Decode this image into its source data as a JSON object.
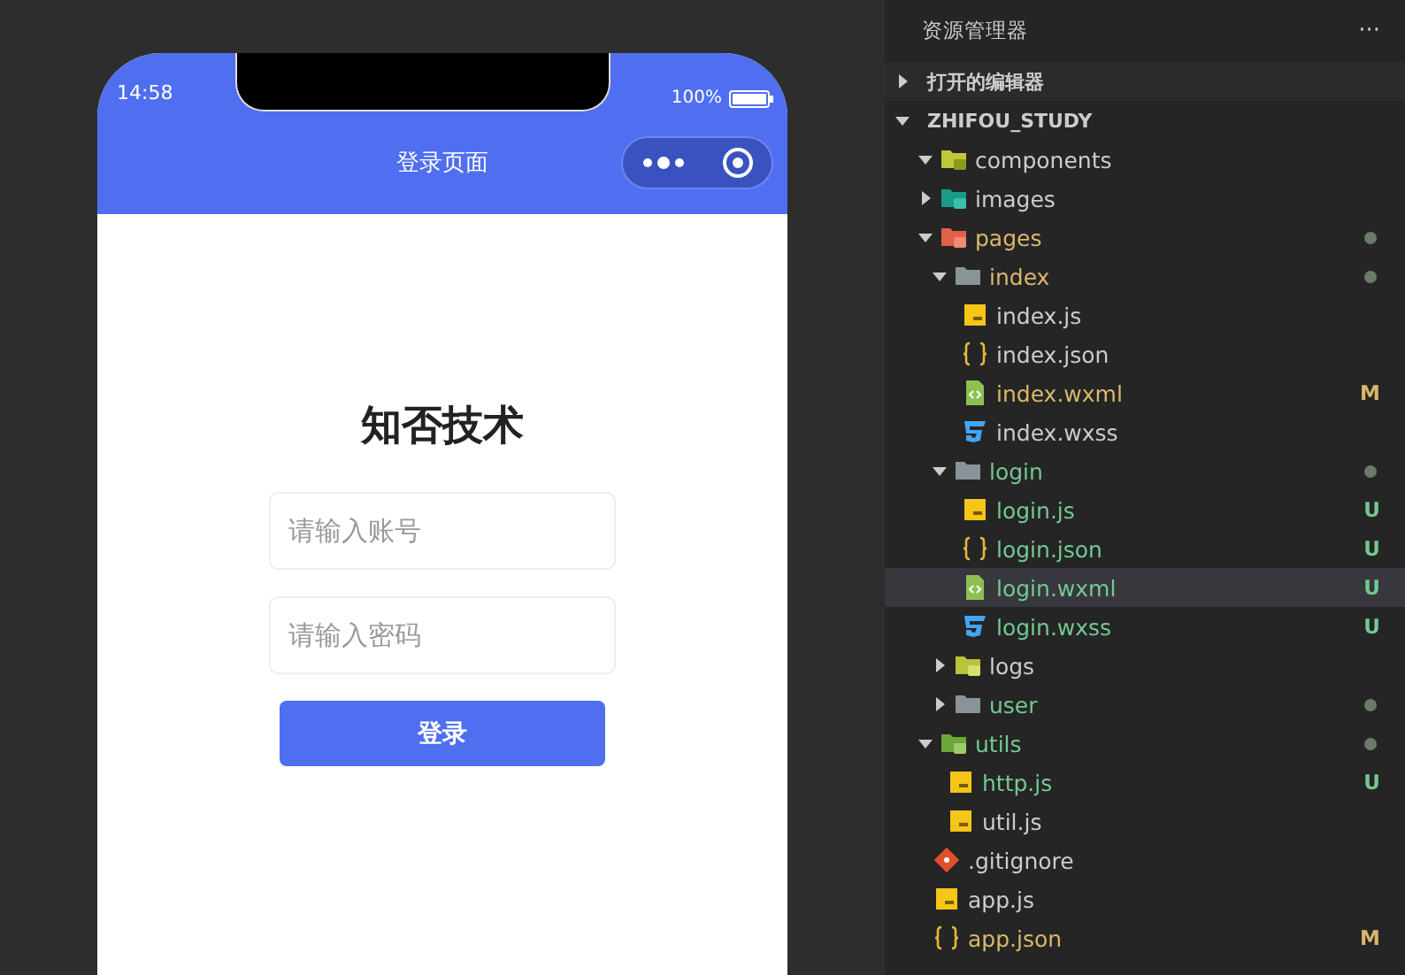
{
  "phone": {
    "status_bar": {
      "time": "14:58",
      "battery": "100%"
    },
    "nav_title": "登录页面",
    "heading": "知否技术",
    "fields": [
      {
        "placeholder": "请输入账号"
      },
      {
        "placeholder": "请输入密码"
      }
    ],
    "login_button": "登录"
  },
  "explorer": {
    "title": "资源管理器",
    "more": "···",
    "sections": [
      {
        "label": "打开的编辑器",
        "expanded": false
      },
      {
        "label": "ZHIFOU_STUDY",
        "expanded": true
      }
    ],
    "tree": [
      {
        "name": "components",
        "kind": "folder-components",
        "expanded": true,
        "color": "#cccccc",
        "selected": false
      },
      {
        "name": "images",
        "kind": "folder-images",
        "expanded": false,
        "color": "#cccccc",
        "selected": false
      },
      {
        "name": "pages",
        "kind": "folder-pages",
        "expanded": true,
        "color": "#d9b86a",
        "dot": true,
        "selected": false,
        "children": [
          {
            "name": "index",
            "kind": "folder",
            "expanded": true,
            "color": "#d9b86a",
            "dot": true,
            "selected": false,
            "children": [
              {
                "name": "index.js",
                "kind": "js",
                "color": "#cccccc",
                "selected": false
              },
              {
                "name": "index.json",
                "kind": "json",
                "color": "#cccccc",
                "selected": false
              },
              {
                "name": "index.wxml",
                "kind": "wxml",
                "color": "#d9b86a",
                "status": "M",
                "selected": false
              },
              {
                "name": "index.wxss",
                "kind": "wxss",
                "color": "#cccccc",
                "selected": false
              }
            ]
          },
          {
            "name": "login",
            "kind": "folder",
            "expanded": true,
            "color": "#73c991",
            "dot": true,
            "selected": false,
            "children": [
              {
                "name": "login.js",
                "kind": "js",
                "color": "#73c991",
                "status": "U",
                "selected": false
              },
              {
                "name": "login.json",
                "kind": "json",
                "color": "#73c991",
                "status": "U",
                "selected": false
              },
              {
                "name": "login.wxml",
                "kind": "wxml",
                "color": "#73c991",
                "status": "U",
                "selected": true
              },
              {
                "name": "login.wxss",
                "kind": "wxss",
                "color": "#73c991",
                "status": "U",
                "selected": false
              }
            ]
          },
          {
            "name": "logs",
            "kind": "folder-logs",
            "expanded": false,
            "color": "#cccccc",
            "selected": false
          },
          {
            "name": "user",
            "kind": "folder",
            "expanded": false,
            "color": "#73c991",
            "dot": true,
            "selected": false
          }
        ]
      },
      {
        "name": "utils",
        "kind": "folder-utils",
        "expanded": true,
        "color": "#73c991",
        "dot": true,
        "selected": false,
        "children": [
          {
            "name": "http.js",
            "kind": "js",
            "color": "#73c991",
            "status": "U",
            "selected": false
          },
          {
            "name": "util.js",
            "kind": "js",
            "color": "#cccccc",
            "selected": false
          }
        ]
      },
      {
        "name": ".gitignore",
        "kind": "git",
        "color": "#cccccc",
        "selected": false
      },
      {
        "name": "app.js",
        "kind": "js",
        "color": "#cccccc",
        "selected": false
      },
      {
        "name": "app.json",
        "kind": "json",
        "color": "#d9b86a",
        "status": "M",
        "selected": false
      }
    ]
  }
}
